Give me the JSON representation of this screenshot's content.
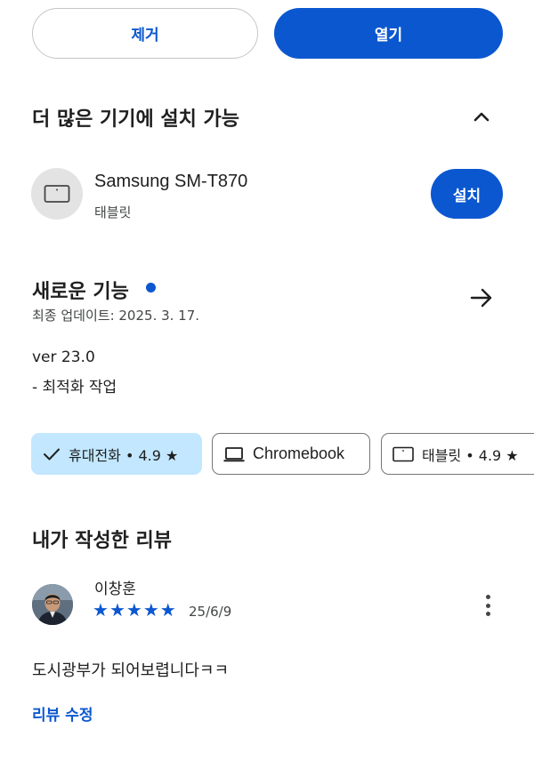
{
  "actions": {
    "remove_label": "제거",
    "open_label": "열기"
  },
  "more_devices": {
    "title": "더 많은 기기에 설치 가능",
    "toggle_icon": "chevron-up-icon",
    "device": {
      "name": "Samsung SM-T870",
      "type": "태블릿",
      "install_label": "설치",
      "icon": "tablet-icon"
    }
  },
  "whats_new": {
    "title": "새로운 기능",
    "updated": "최종 업데이트: 2025. 3. 17.",
    "version": "ver 23.0",
    "notes": "- 최적화 작업",
    "arrow_icon": "arrow-right-icon"
  },
  "chips": [
    {
      "label": "휴대전화 • 4.9 ★",
      "icon": "check-icon",
      "selected": true
    },
    {
      "label": "Chromebook",
      "icon": "laptop-icon",
      "selected": false
    },
    {
      "label": "태블릿 • 4.9 ★",
      "icon": "tablet-icon",
      "selected": false
    }
  ],
  "my_review": {
    "title": "내가 작성한 리뷰",
    "reviewer": "이창훈",
    "rating": 5,
    "stars": "★★★★★",
    "date": "25/6/9",
    "text": "도시광부가 되어보렵니다ㅋㅋ",
    "edit_label": "리뷰 수정"
  },
  "colors": {
    "accent": "#0b57d0",
    "chip_selected_bg": "#c2e7ff",
    "device_circle_bg": "#e3e3e3"
  }
}
